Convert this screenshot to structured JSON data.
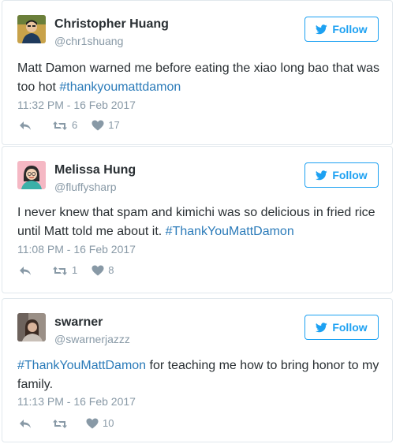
{
  "tweets": [
    {
      "name": "Christopher Huang",
      "handle": "@chr1shuang",
      "follow_label": "Follow",
      "text_plain": "Matt Damon warned me before eating the xiao long bao that was too hot ",
      "hashtag": "#thankyoumattdamon",
      "timestamp": "11:32 PM - 16 Feb 2017",
      "retweets": "6",
      "likes": "17"
    },
    {
      "name": "Melissa Hung",
      "handle": "@fluffysharp",
      "follow_label": "Follow",
      "text_plain": "I never knew that spam and kimichi was so delicious in fried rice until Matt told me about it. ",
      "hashtag": "#ThankYouMattDamon",
      "timestamp": "11:08 PM - 16 Feb 2017",
      "retweets": "1",
      "likes": "8"
    },
    {
      "name": "swarner",
      "handle": "@swarnerjazzz",
      "follow_label": "Follow",
      "hashtag": "#ThankYouMattDamon",
      "text_plain": " for teaching me how to bring honor to my family.",
      "timestamp": "11:13 PM - 16 Feb 2017",
      "retweets": "",
      "likes": "10"
    }
  ],
  "colors": {
    "accent": "#1da1f2",
    "hashtag": "#2b7bb9",
    "muted": "#8899a6",
    "text": "#292f33",
    "border": "#e1e8ed"
  },
  "icons": [
    "reply-icon",
    "retweet-icon",
    "heart-icon",
    "twitter-bird-icon"
  ]
}
